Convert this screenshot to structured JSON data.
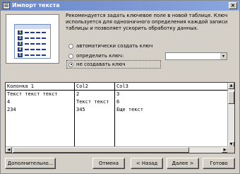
{
  "window": {
    "title": "Импорт текста",
    "close_glyph": "×"
  },
  "description": "Рекомендуется задать ключевое поле в новой таблице. Ключ используется для однозначного определения каждой записи таблицы и позволяет ускорить обработку данных.",
  "illustration": {
    "row_numbers": [
      "1",
      "2",
      "3",
      "4",
      "5"
    ]
  },
  "key_options": {
    "auto": "автоматически создать ключ",
    "define": "определить ключ:",
    "none": "не создавать ключ",
    "selected": "none",
    "define_value": "",
    "combo_arrow": "▾"
  },
  "preview": {
    "columns": [
      "Колонка 1",
      "Col2",
      "Col3"
    ],
    "rows": [
      [
        "Текст текст текст",
        "2",
        "3"
      ],
      [
        "4",
        "Текст текст",
        "6"
      ],
      [
        "234",
        "345",
        "Еще текст"
      ]
    ]
  },
  "scroll": {
    "up": "▲",
    "down": "▼",
    "left": "◀",
    "right": "▶"
  },
  "buttons": {
    "advanced": "Дополнительно...",
    "cancel": "Отмена",
    "back": "< Назад",
    "next": "Далее >",
    "finish": "Готово"
  },
  "colors": {
    "dialog_bg": "#d4d0c8",
    "title_bar": "#7b97d3",
    "illustration_blue": "#1f3aa8"
  }
}
